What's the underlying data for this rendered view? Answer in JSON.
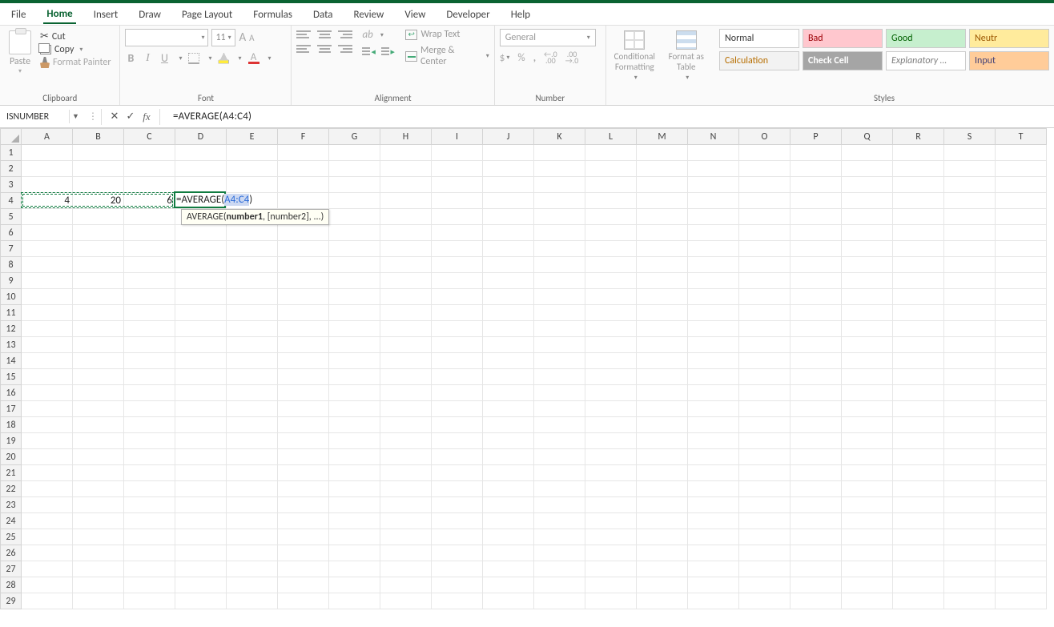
{
  "tabs": {
    "file": "File",
    "home": "Home",
    "insert": "Insert",
    "draw": "Draw",
    "page_layout": "Page Layout",
    "formulas": "Formulas",
    "data": "Data",
    "review": "Review",
    "view": "View",
    "developer": "Developer",
    "help": "Help"
  },
  "clipboard": {
    "paste": "Paste",
    "cut": "Cut",
    "copy": "Copy",
    "format_painter": "Format Painter",
    "group": "Clipboard"
  },
  "font": {
    "name": "",
    "size": "11",
    "group": "Font",
    "bold": "B",
    "italic": "I",
    "underline": "U",
    "a_big": "A",
    "a_small": "A",
    "color_A": "A"
  },
  "alignment": {
    "group": "Alignment",
    "wrap": "Wrap Text",
    "merge": "Merge & Center",
    "orient": "ab"
  },
  "number": {
    "group": "Number",
    "format": "General",
    "dollar": "$",
    "percent": "%",
    "comma": ",",
    "dec1": ".0 .00",
    "dec2": ".00 .0"
  },
  "condfmt": "Conditional Formatting",
  "fmt_table": "Format as Table",
  "styles": {
    "group": "Styles",
    "cells": [
      "Normal",
      "Bad",
      "Good",
      "Neutr",
      "Calculation",
      "Check Cell",
      "Explanatory …",
      "Input"
    ]
  },
  "namebox": "ISNUMBER",
  "formula": "=AVERAGE(A4:C4)",
  "cell_edit": {
    "pre": "=AVERAGE(",
    "range": "A4:C4",
    "post": ")"
  },
  "tooltip": {
    "fn": "AVERAGE(",
    "arg1": "number1",
    "rest": ", [number2], ...)"
  },
  "columns": [
    "A",
    "B",
    "C",
    "D",
    "E",
    "F",
    "G",
    "H",
    "I",
    "J",
    "K",
    "L",
    "M",
    "N",
    "O",
    "P",
    "Q",
    "R",
    "S",
    "T"
  ],
  "rows": 29,
  "data_cells": {
    "A4": "4",
    "B4": "20",
    "C4": "6"
  },
  "chart_data": null
}
